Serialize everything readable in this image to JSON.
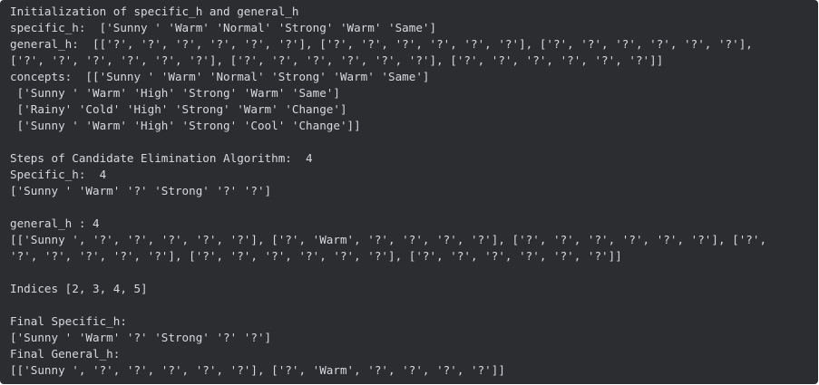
{
  "output": {
    "lines": [
      "Initialization of specific_h and general_h",
      "specific_h:  ['Sunny ' 'Warm' 'Normal' 'Strong' 'Warm' 'Same']",
      "general_h:  [['?', '?', '?', '?', '?', '?'], ['?', '?', '?', '?', '?', '?'], ['?', '?', '?', '?', '?', '?'],",
      "['?', '?', '?', '?', '?', '?'], ['?', '?', '?', '?', '?', '?'], ['?', '?', '?', '?', '?', '?']]",
      "concepts:  [['Sunny ' 'Warm' 'Normal' 'Strong' 'Warm' 'Same']",
      " ['Sunny ' 'Warm' 'High' 'Strong' 'Warm' 'Same']",
      " ['Rainy' 'Cold' 'High' 'Strong' 'Warm' 'Change']",
      " ['Sunny ' 'Warm' 'High' 'Strong' 'Cool' 'Change']]",
      "",
      "Steps of Candidate Elimination Algorithm:  4",
      "Specific_h:  4",
      "['Sunny ' 'Warm' '?' 'Strong' '?' '?']",
      "",
      "general_h : 4",
      "[['Sunny ', '?', '?', '?', '?', '?'], ['?', 'Warm', '?', '?', '?', '?'], ['?', '?', '?', '?', '?', '?'], ['?',",
      "'?', '?', '?', '?', '?'], ['?', '?', '?', '?', '?', '?'], ['?', '?', '?', '?', '?', '?']]",
      "",
      "Indices [2, 3, 4, 5]",
      "",
      "Final Specific_h:",
      "['Sunny ' 'Warm' '?' 'Strong' '?' '?']",
      "Final General_h:",
      "[['Sunny ', '?', '?', '?', '?', '?'], ['?', 'Warm', '?', '?', '?', '?']]"
    ]
  }
}
